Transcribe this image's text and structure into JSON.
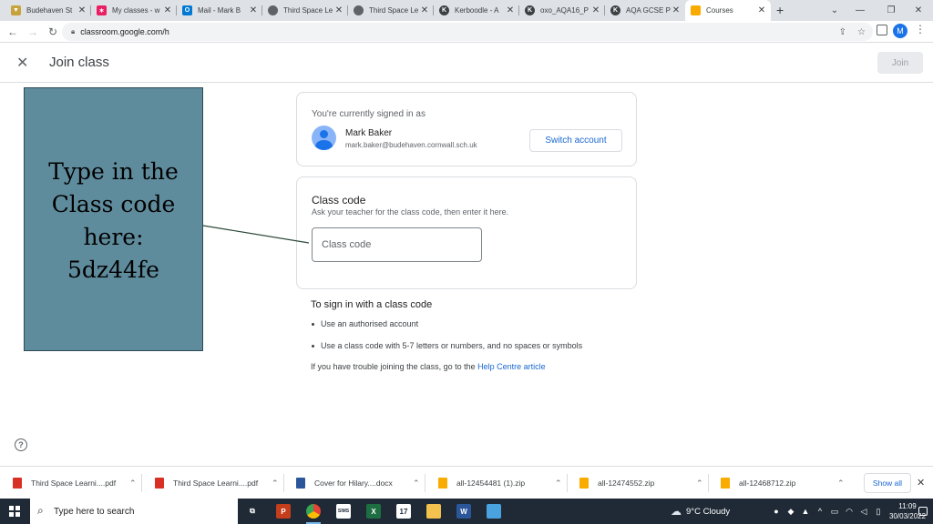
{
  "browser": {
    "tabs": [
      {
        "title": "Budehaven St",
        "icon": "school-crest-icon",
        "color": "#c8a23a"
      },
      {
        "title": "My classes - w",
        "icon": "colorful-star-icon",
        "color": "#e91e63"
      },
      {
        "title": "Mail - Mark B",
        "icon": "outlook-icon",
        "color": "#0078d4"
      },
      {
        "title": "Third Space Le",
        "icon": "globe-icon",
        "color": "#5f6368"
      },
      {
        "title": "Third Space Le",
        "icon": "globe-icon",
        "color": "#5f6368"
      },
      {
        "title": "Kerboodle - A",
        "icon": "kerboodle-icon",
        "color": "#3c4043"
      },
      {
        "title": "oxo_AQA16_P",
        "icon": "kerboodle-icon",
        "color": "#3c4043"
      },
      {
        "title": "AQA GCSE Phy",
        "icon": "kerboodle-icon",
        "color": "#3c4043"
      },
      {
        "title": "Courses",
        "icon": "google-classroom-icon",
        "color": "#f9ab00",
        "active": true
      }
    ],
    "new_tab": "+",
    "url": "classroom.google.com/h",
    "profile_initial": "M"
  },
  "header": {
    "title": "Join class",
    "join_button": "Join"
  },
  "callout": {
    "lines": [
      "Type in the",
      "Class code",
      "here:",
      "5dz44fe"
    ]
  },
  "account": {
    "signed_in_label": "You're currently signed in as",
    "name": "Mark Baker",
    "email": "mark.baker@budehaven.cornwall.sch.uk",
    "switch_button": "Switch account"
  },
  "class_code": {
    "title": "Class code",
    "description": "Ask your teacher for the class code, then enter it here.",
    "placeholder": "Class code",
    "value": ""
  },
  "instructions": {
    "title": "To sign in with a class code",
    "bullets": [
      "Use an authorised account",
      "Use a class code with 5-7 letters or numbers, and no spaces or symbols"
    ],
    "help_prefix": "If you have trouble joining the class, go to the ",
    "help_link": "Help Centre article"
  },
  "downloads": {
    "items": [
      {
        "name": "Third Space Learni....pdf",
        "type": "pdf",
        "color": "#d93025"
      },
      {
        "name": "Third Space Learni....pdf",
        "type": "pdf",
        "color": "#d93025"
      },
      {
        "name": "Cover for Hilary....docx",
        "type": "docx",
        "color": "#2b579a"
      },
      {
        "name": "all-12454481 (1).zip",
        "type": "zip",
        "color": "#f9ab00"
      },
      {
        "name": "all-12474552.zip",
        "type": "zip",
        "color": "#f9ab00"
      },
      {
        "name": "all-12468712.zip",
        "type": "zip",
        "color": "#f9ab00"
      }
    ],
    "show_all": "Show all"
  },
  "taskbar": {
    "search_placeholder": "Type here to search",
    "weather_temp": "9°C",
    "weather_text": "Cloudy",
    "time": "11:09",
    "date": "30/03/2022"
  }
}
